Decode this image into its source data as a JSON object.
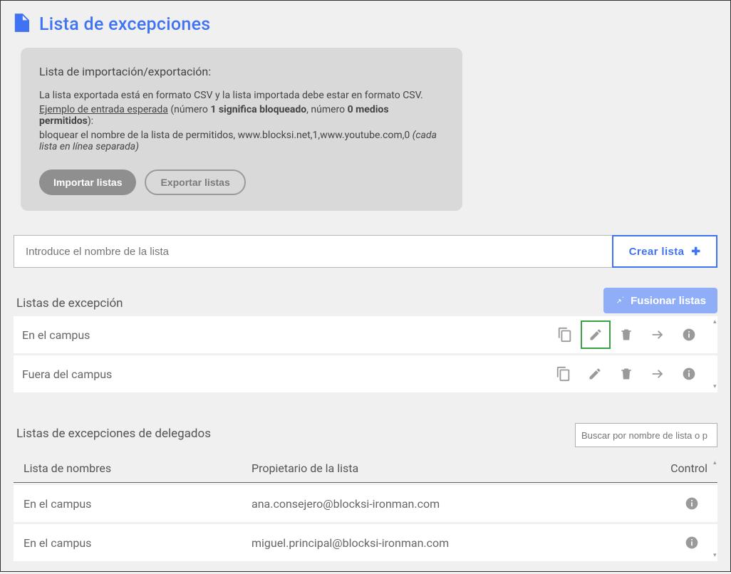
{
  "header": {
    "title": "Lista de excepciones"
  },
  "info_box": {
    "heading": "Lista de importación/exportación:",
    "line1": "La lista exportada está en formato CSV y la lista importada debe estar en formato CSV.",
    "link_text": "Ejemplo de entrada esperada",
    "paren_pre": " (número ",
    "bold1": "1 significa bloqueado",
    "paren_mid": ", número ",
    "bold2": "0 medios permitidos",
    "paren_post": "):",
    "example": "bloquear el nombre de la lista de permitidos, www.blocksi.net,1,www.youtube.com,0   ",
    "italic_note": "(cada lista en línea separada)",
    "import_btn": "Importar listas",
    "export_btn": "Exportar listas"
  },
  "create": {
    "placeholder": "Introduce el nombre de la lista",
    "button_label": "Crear lista"
  },
  "exception_lists": {
    "heading": "Listas de excepción",
    "merge_btn": "Fusionar listas",
    "rows": [
      {
        "name": "En el campus",
        "hi_edit": true
      },
      {
        "name": "Fuera del campus",
        "hi_edit": false
      }
    ],
    "icon_names": {
      "copy": "copy-icon",
      "edit": "pencil-icon",
      "delete": "trash-icon",
      "go": "arrow-right-icon",
      "info": "info-icon"
    }
  },
  "delegate": {
    "heading": "Listas de excepciones de delegados",
    "search_placeholder": "Buscar por nombre de lista o p",
    "columns": {
      "name": "Lista de nombres",
      "owner": "Propietario de la lista",
      "control": "Control"
    },
    "rows": [
      {
        "name": "En el campus",
        "owner": "ana.consejero@blocksi-ironman.com"
      },
      {
        "name": "En el campus",
        "owner": "miguel.principal@blocksi-ironman.com"
      }
    ]
  }
}
